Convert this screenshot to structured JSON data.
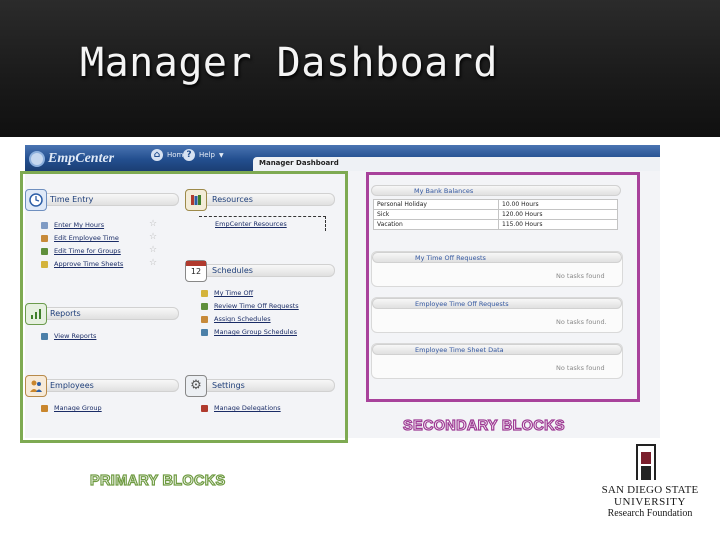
{
  "slide": {
    "title": "Manager Dashboard",
    "label_primary": "PRIMARY BLOCKS",
    "label_secondary": "SECONDARY BLOCKS",
    "colors": {
      "primary_frame": "#7eaa52",
      "secondary_frame": "#a8429b",
      "nav_blue": "#234f8f"
    }
  },
  "app": {
    "logo": "EmpCenter",
    "nav": {
      "home": "Home",
      "help": "Help"
    },
    "tab": "Manager Dashboard",
    "primary_blocks": {
      "time_entry": {
        "title": "Time Entry",
        "icon": "clock-icon",
        "links": [
          "Enter My Hours",
          "Edit Employee Time",
          "Edit Time for Groups",
          "Approve Time Sheets"
        ]
      },
      "resources": {
        "title": "Resources",
        "icon": "books-icon",
        "links": [
          "EmpCenter Resources"
        ]
      },
      "schedules": {
        "title": "Schedules",
        "icon": "calendar-icon",
        "calendar_day": "12",
        "links": [
          "My Time Off",
          "Review Time Off Requests",
          "Assign Schedules",
          "Manage Group Schedules"
        ]
      },
      "reports": {
        "title": "Reports",
        "icon": "chart-icon",
        "links": [
          "View Reports"
        ]
      },
      "employees": {
        "title": "Employees",
        "icon": "people-icon",
        "links": [
          "Manage Group"
        ]
      },
      "settings": {
        "title": "Settings",
        "icon": "gear-icon",
        "links": [
          "Manage Delegations"
        ]
      }
    },
    "secondary_blocks": {
      "bank_balances": {
        "title": "My Bank Balances",
        "rows": [
          {
            "name": "Personal Holiday",
            "value": "10.00 Hours"
          },
          {
            "name": "Sick",
            "value": "120.00 Hours"
          },
          {
            "name": "Vacation",
            "value": "115.00 Hours"
          }
        ]
      },
      "time_off_requests": {
        "title": "My Time Off Requests",
        "empty": "No tasks found"
      },
      "employee_time_off": {
        "title": "Employee Time Off Requests",
        "empty": "No tasks found."
      },
      "employee_time_sheet": {
        "title": "Employee Time Sheet Data",
        "empty": "No tasks found"
      }
    }
  },
  "sdsu": {
    "line1": "SAN DIEGO STATE",
    "line2": "UNIVERSITY",
    "line3": "Research Foundation"
  }
}
